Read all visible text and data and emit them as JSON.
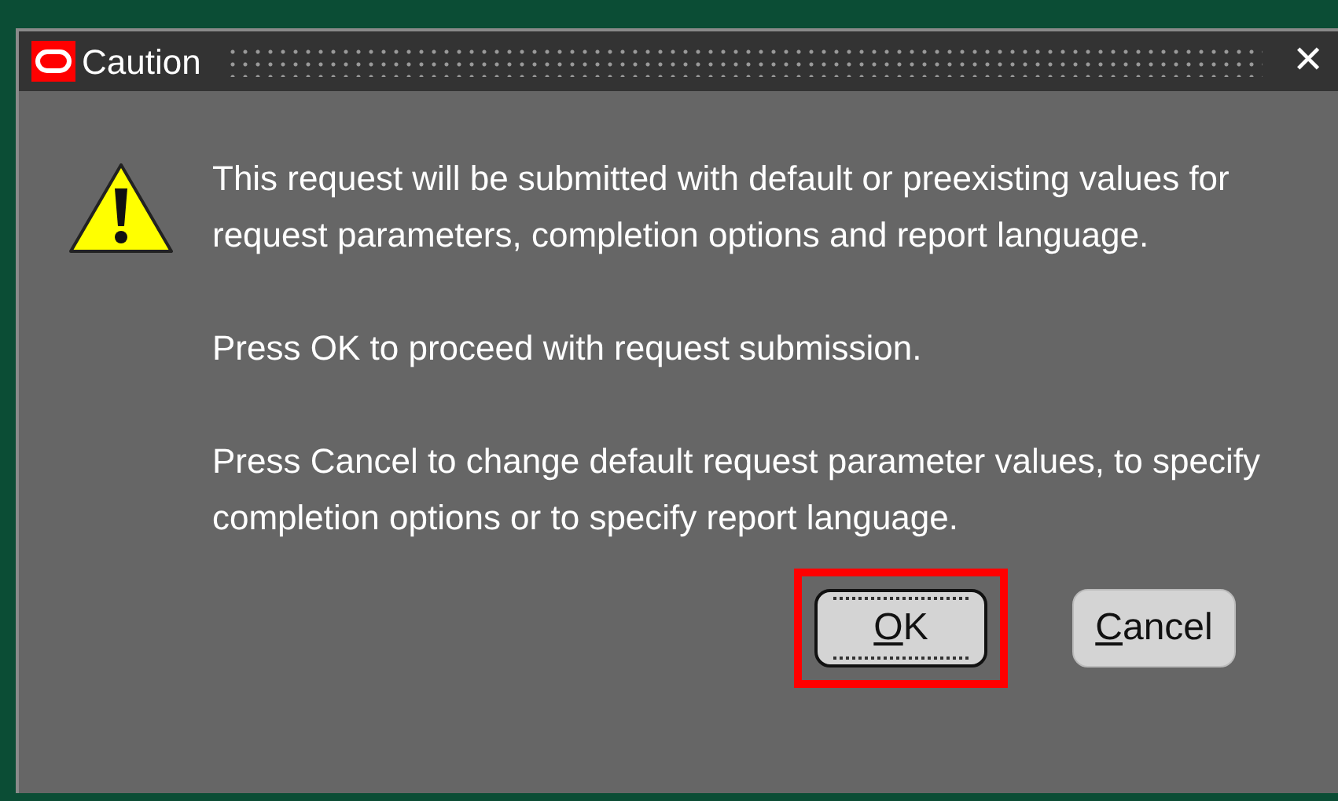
{
  "window": {
    "title": "Caution",
    "close": "✕"
  },
  "message": [
    "This request will be submitted with default or preexisting values for request parameters, completion options and report language.",
    "Press OK to proceed with request submission.",
    "Press Cancel to change default request parameter values, to specify completion options or to specify report language."
  ],
  "buttons": [
    {
      "access_key": "O",
      "label_rest": "K",
      "focused": true,
      "highlighted": true
    },
    {
      "access_key": "C",
      "label_rest": "ancel",
      "focused": false,
      "highlighted": false
    }
  ]
}
